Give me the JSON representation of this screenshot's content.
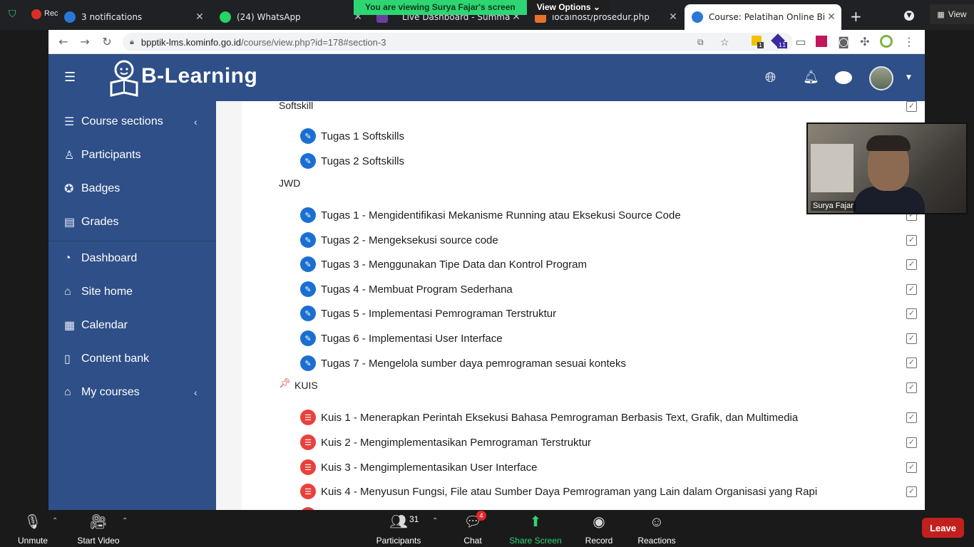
{
  "browser": {
    "tabs": [
      {
        "label": "3 notifications",
        "color": "#2a78d6"
      },
      {
        "label": "(24) WhatsApp",
        "color": "#25d366"
      },
      {
        "label": "Live Dashboard - Summary",
        "color": "#6b3fa0"
      },
      {
        "label": "localhost/prosedur.php",
        "color": "#e8722b"
      },
      {
        "label": "Course: Pelatihan Online Bid",
        "color": "#2a78d6"
      }
    ],
    "recording_label": "Rec",
    "view_label": "View",
    "url_host": "bpptik-lms.kominfo.go.id",
    "url_path": "/course/view.php?id=178#section-3",
    "extension_badges": [
      "1",
      "11"
    ]
  },
  "zoom_banner": {
    "viewing_text": "You are viewing Surya Fajar's screen",
    "view_options": "View Options ⌄"
  },
  "lms": {
    "logo_text": "B-Learning",
    "nav": [
      {
        "label": "Course sections",
        "icon": "list-icon"
      },
      {
        "label": "Participants",
        "icon": "users-icon"
      },
      {
        "label": "Badges",
        "icon": "badge-icon"
      },
      {
        "label": "Grades",
        "icon": "grades-icon"
      },
      {
        "label": "Dashboard",
        "icon": "dashboard-icon"
      },
      {
        "label": "Site home",
        "icon": "home-icon"
      },
      {
        "label": "Calendar",
        "icon": "calendar-icon"
      },
      {
        "label": "Content bank",
        "icon": "content-bank-icon"
      },
      {
        "label": "My courses",
        "icon": "graduation-cap-icon"
      }
    ],
    "sections": [
      {
        "title": "Softskill"
      },
      {
        "title": "JWD"
      },
      {
        "title": "KUIS"
      }
    ],
    "softskill_activities": [
      "Tugas 1 Softskills",
      "Tugas 2 Softskills"
    ],
    "jwd_activities": [
      "Tugas 1 - Mengidentifikasi Mekanisme Running atau Eksekusi Source Code",
      "Tugas 2 - Mengeksekusi source code",
      "Tugas 3 - Menggunakan Tipe Data dan Kontrol Program",
      "Tugas 4 - Membuat Program Sederhana",
      "Tugas 5 - Implementasi Pemrograman Terstruktur",
      "Tugas 6 - Implementasi User Interface",
      "Tugas 7 - Mengelola sumber daya pemrograman sesuai konteks"
    ],
    "kuis_activities": [
      "Kuis 1 - Menerapkan Perintah Eksekusi Bahasa Pemrograman Berbasis Text, Grafik, dan Multimedia",
      "Kuis 2 - Mengimplementasikan Pemrograman Terstruktur",
      "Kuis 3 - Mengimplementasikan User Interface",
      "Kuis 4 - Menyusun Fungsi, File atau Sumber Daya Pemrograman yang Lain dalam Organisasi yang Rapi"
    ]
  },
  "video": {
    "name": "Surya Fajar"
  },
  "zoom_controls": {
    "unmute": "Unmute",
    "start_video": "Start Video",
    "participants": "Participants",
    "participants_count": "31",
    "chat": "Chat",
    "chat_badge": "4",
    "share_screen": "Share Screen",
    "record": "Record",
    "reactions": "Reactions",
    "leave": "Leave"
  }
}
